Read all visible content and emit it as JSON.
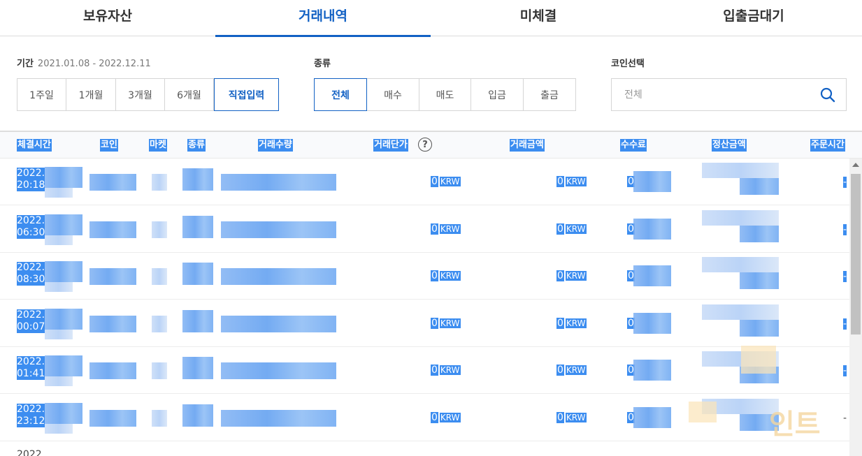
{
  "tabs": [
    {
      "label": "보유자산",
      "active": false
    },
    {
      "label": "거래내역",
      "active": true
    },
    {
      "label": "미체결",
      "active": false
    },
    {
      "label": "입출금대기",
      "active": false
    }
  ],
  "filters": {
    "period_label": "기간",
    "period_range": "2021.01.08 - 2022.12.11",
    "period_options": [
      "1주일",
      "1개월",
      "3개월",
      "6개월",
      "직접입력"
    ],
    "period_selected": "직접입력",
    "type_label": "종류",
    "type_options": [
      "전체",
      "매수",
      "매도",
      "입금",
      "출금"
    ],
    "type_selected": "전체",
    "coin_label": "코인선택",
    "coin_placeholder": "전체"
  },
  "table": {
    "headers": [
      "체결시간",
      "코인",
      "마켓",
      "종류",
      "거래수량",
      "거래단가",
      "거래금액",
      "수수료",
      "정산금액",
      "주문시간"
    ],
    "help_icon": "?",
    "rows": [
      {
        "date": "2022.",
        "time": "20:18",
        "unit_price": "0",
        "unit_currency": "KRW",
        "amount": "0",
        "amount_currency": "KRW",
        "fee": "0",
        "order_time": "-"
      },
      {
        "date": "2022.",
        "time": "06:30",
        "unit_price": "0",
        "unit_currency": "KRW",
        "amount": "0",
        "amount_currency": "KRW",
        "fee": "0",
        "order_time": "-"
      },
      {
        "date": "2022.",
        "time": "08:30",
        "unit_price": "0",
        "unit_currency": "KRW",
        "amount": "0",
        "amount_currency": "KRW",
        "fee": "0",
        "order_time": "-"
      },
      {
        "date": "2022.",
        "time": "00:07",
        "unit_price": "0",
        "unit_currency": "KRW",
        "amount": "0",
        "amount_currency": "KRW",
        "fee": "0",
        "order_time": "-"
      },
      {
        "date": "2022.",
        "time": "01:41",
        "unit_price": "0",
        "unit_currency": "KRW",
        "amount": "0",
        "amount_currency": "KRW",
        "fee": "0",
        "order_time": "-"
      },
      {
        "date": "2022.",
        "time": "23:12",
        "unit_price": "0",
        "unit_currency": "KRW",
        "amount": "0",
        "amount_currency": "KRW",
        "fee": "0",
        "order_time": "-"
      }
    ],
    "partial_row_date": "2022."
  },
  "watermark": "인트",
  "colors": {
    "accent": "#1261c4",
    "selection": "#3c8df0"
  }
}
